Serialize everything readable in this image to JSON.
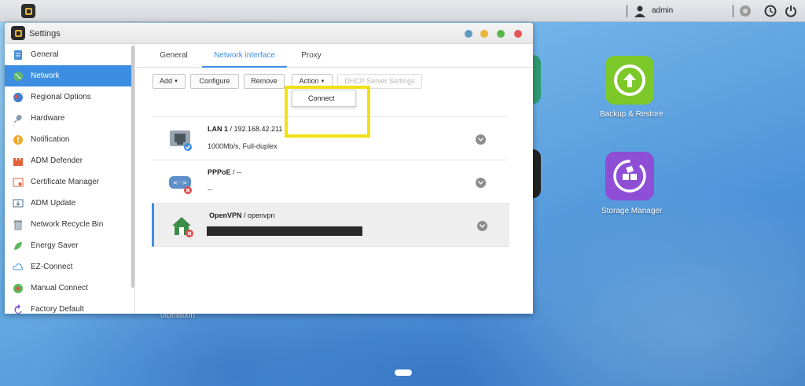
{
  "taskbar": {
    "user_label": "admin"
  },
  "desktop": {
    "icons": [
      {
        "label": "Backup & Restore",
        "color": "#7cc829"
      },
      {
        "label": "Storage Manager",
        "color": "#8e4fd6"
      }
    ],
    "partial_label": "utomation"
  },
  "window": {
    "title": "Settings",
    "controls": [
      "#5b9bbf",
      "#e9b43a",
      "#58b74a",
      "#e25555"
    ]
  },
  "sidebar": {
    "items": [
      {
        "label": "General",
        "icon": "general-icon"
      },
      {
        "label": "Network",
        "icon": "globe-icon",
        "active": true
      },
      {
        "label": "Regional Options",
        "icon": "regional-icon"
      },
      {
        "label": "Hardware",
        "icon": "hardware-icon"
      },
      {
        "label": "Notification",
        "icon": "notification-icon"
      },
      {
        "label": "ADM Defender",
        "icon": "defender-icon"
      },
      {
        "label": "Certificate Manager",
        "icon": "certificate-icon"
      },
      {
        "label": "ADM Update",
        "icon": "update-icon"
      },
      {
        "label": "Network Recycle Bin",
        "icon": "recycle-bin-icon"
      },
      {
        "label": "Energy Saver",
        "icon": "energy-icon"
      },
      {
        "label": "EZ-Connect",
        "icon": "cloud-icon"
      },
      {
        "label": "Manual Connect",
        "icon": "manual-connect-icon"
      },
      {
        "label": "Factory Default",
        "icon": "factory-default-icon"
      }
    ]
  },
  "tabs": [
    {
      "label": "General"
    },
    {
      "label": "Network interface",
      "active": true
    },
    {
      "label": "Proxy"
    }
  ],
  "toolbar": {
    "add_label": "Add",
    "configure_label": "Configure",
    "remove_label": "Remove",
    "action_label": "Action",
    "dhcp_label": "DHCP Server Settings"
  },
  "action_menu": {
    "items": [
      "Connect"
    ]
  },
  "interfaces": [
    {
      "name": "LAN 1",
      "detail": " / 192.168.42.211",
      "sub": "1000Mb/s, Full-duplex",
      "status": "connected"
    },
    {
      "name": "PPPoE",
      "detail": " / --",
      "sub": "--",
      "status": "disconnected"
    },
    {
      "name": "OpenVPN",
      "detail": " / openvpn",
      "sub": "",
      "status": "disconnected",
      "selected": true
    }
  ]
}
